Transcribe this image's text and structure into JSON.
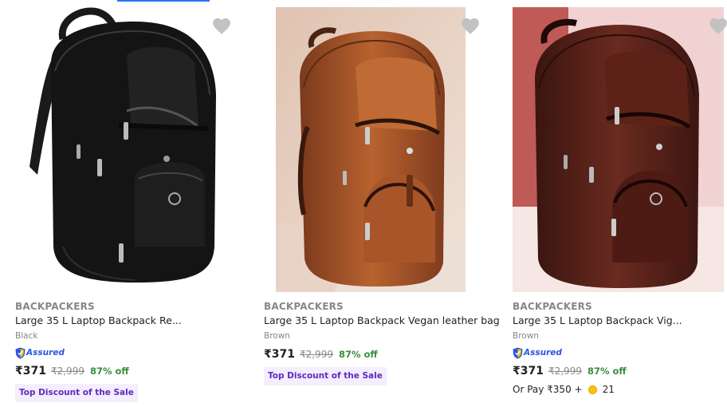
{
  "products": [
    {
      "brand": "BACKPACKERS",
      "title": "Large 35 L Laptop Backpack Re...",
      "color": "Black",
      "assured_label": "Assured",
      "price": "₹371",
      "mrp": "₹2,999",
      "discount": "87% off",
      "badge": "Top Discount of the Sale"
    },
    {
      "brand": "BACKPACKERS",
      "title": "Large 35 L Laptop Backpack Vegan leather bag",
      "color": "Brown",
      "price": "₹371",
      "mrp": "₹2,999",
      "discount": "87% off",
      "badge": "Top Discount of the Sale"
    },
    {
      "brand": "BACKPACKERS",
      "title": "Large 35 L Laptop Backpack Vig...",
      "color": "Brown",
      "assured_label": "Assured",
      "price": "₹371",
      "mrp": "₹2,999",
      "discount": "87% off",
      "or_pay": "Or Pay ₹350 +",
      "coins": "21"
    }
  ],
  "colors": {
    "discount_green": "#388e3c",
    "assured_blue": "#2a55e5",
    "badge_bg": "#f4eefe",
    "badge_text": "#5b2cbf",
    "wishlist_gray": "#c2c2c2"
  },
  "icons": [
    "heart-icon",
    "assured-shield-icon",
    "supercoin-icon"
  ]
}
